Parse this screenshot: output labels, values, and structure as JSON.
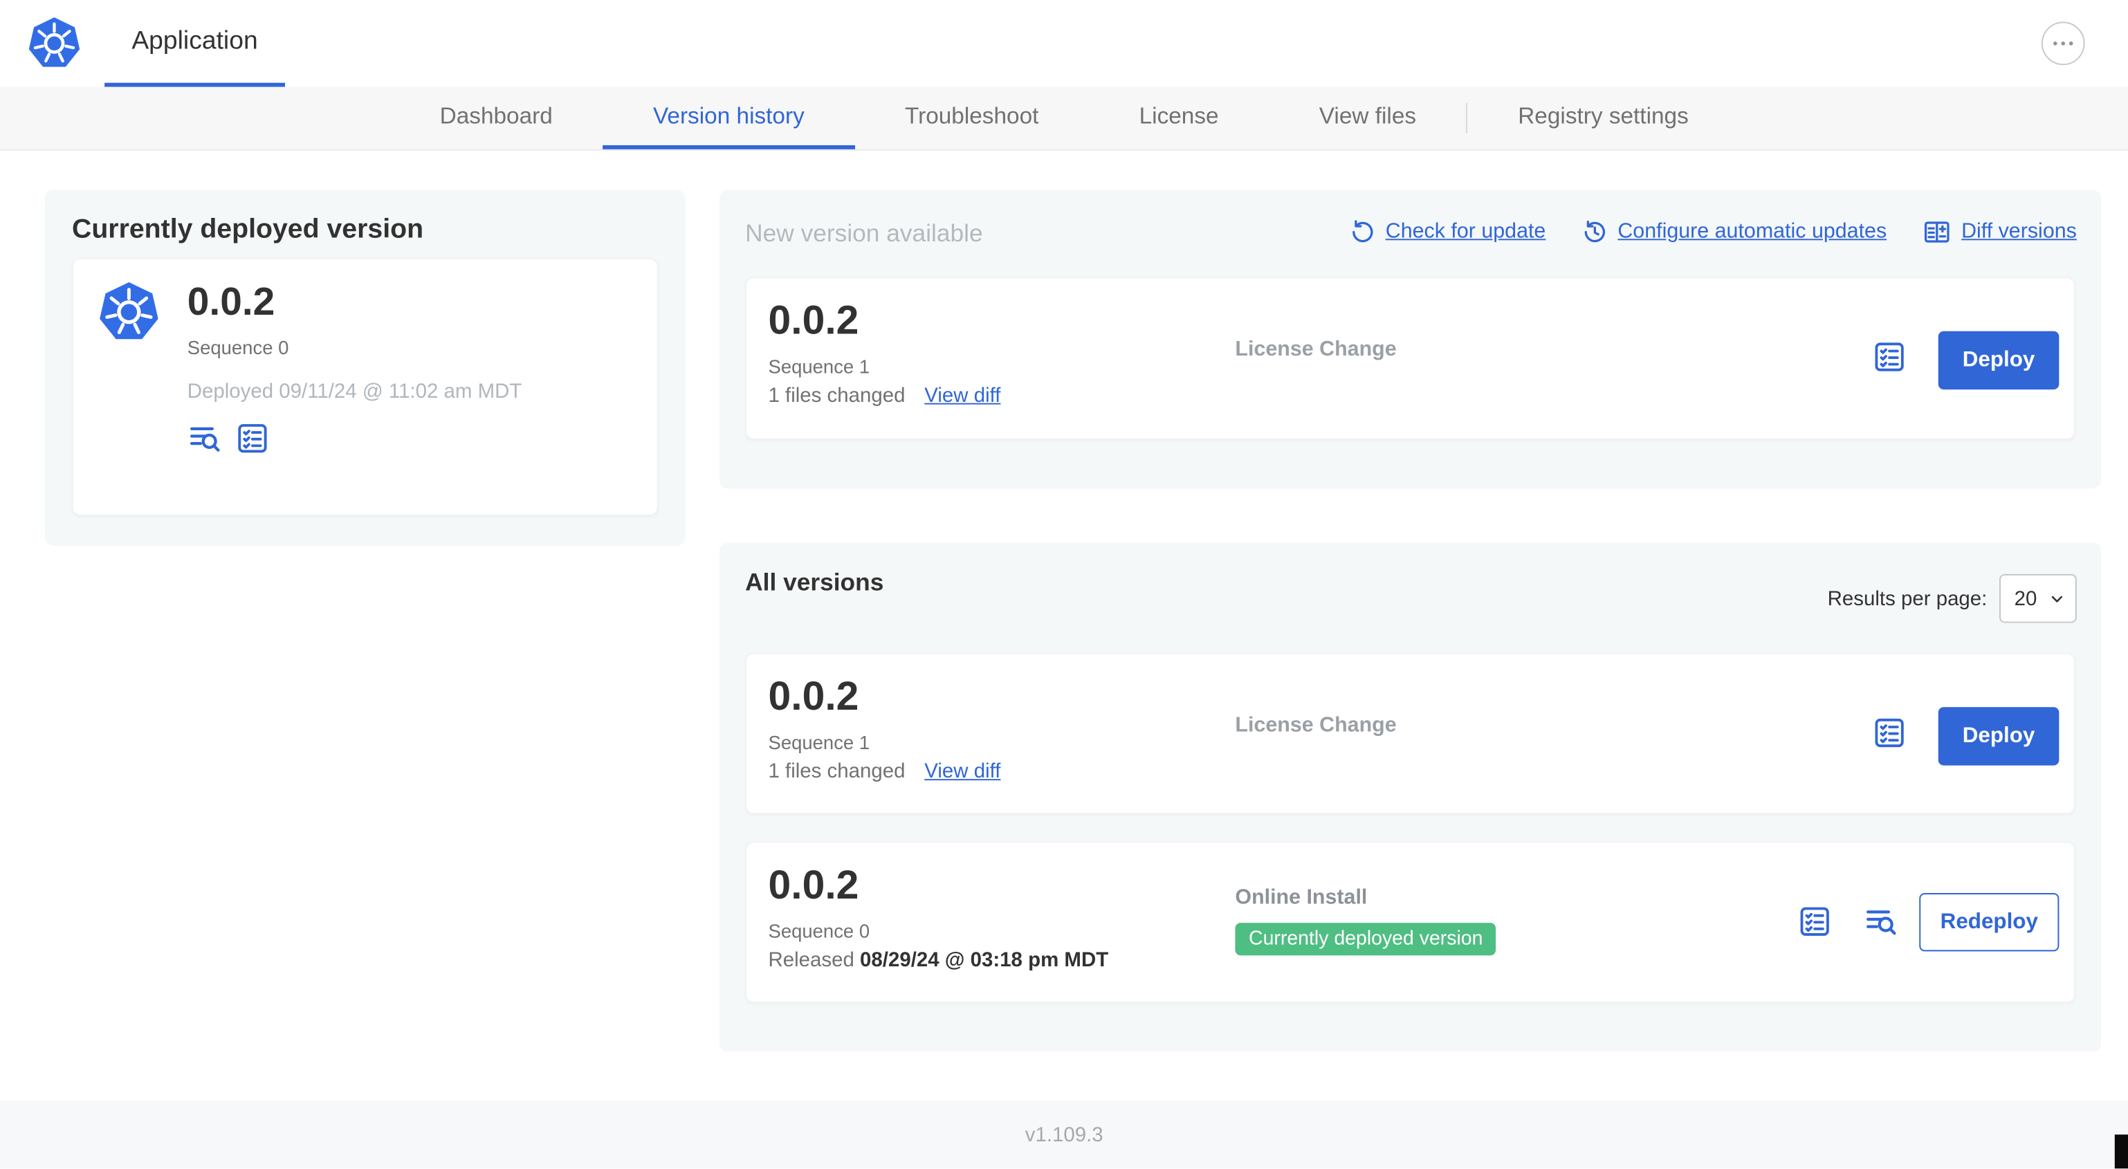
{
  "colors": {
    "accent": "#3066d6",
    "k8s_blue": "#326de6",
    "badge_green": "#4fbe83",
    "card_bg": "#f5f8f9"
  },
  "icons": {
    "kubernetes-logo": "blue-heptagon-helm-wheel",
    "more": "horizontal-ellipsis-dots",
    "check-for-update": "circular-refresh-arrow",
    "configure-automatic-updates": "clock-with-refresh-arrow",
    "diff-versions": "split-table-diff",
    "release-notes": "checklist-in-rounded-square",
    "view-logs": "text-lines-with-magnifier",
    "select-chevron": "chevron-down"
  },
  "header": {
    "app_tab": "Application"
  },
  "nav": {
    "tabs": [
      {
        "label": "Dashboard",
        "active": false
      },
      {
        "label": "Version history",
        "active": true
      },
      {
        "label": "Troubleshoot",
        "active": false
      },
      {
        "label": "License",
        "active": false
      },
      {
        "label": "View files",
        "active": false
      },
      {
        "label": "Registry settings",
        "active": false
      }
    ]
  },
  "current_version": {
    "title": "Currently deployed version",
    "version": "0.0.2",
    "sequence": "Sequence 0",
    "deployed": "Deployed 09/11/24 @ 11:02 am MDT"
  },
  "new_version": {
    "title": "New version available",
    "actions": [
      {
        "label": "Check for update"
      },
      {
        "label": "Configure automatic updates"
      },
      {
        "label": "Diff versions"
      }
    ],
    "card": {
      "version": "0.0.2",
      "sequence": "Sequence 1",
      "files_changed": "1 files changed",
      "view_diff": "View diff",
      "source": "License Change",
      "deploy_label": "Deploy"
    }
  },
  "all_versions": {
    "title": "All versions",
    "results_per_page_label": "Results per page:",
    "results_per_page_value": "20",
    "rows": [
      {
        "version": "0.0.2",
        "sequence": "Sequence 1",
        "files_changed": "1 files changed",
        "view_diff": "View diff",
        "source": "License Change",
        "action_label": "Deploy"
      },
      {
        "version": "0.0.2",
        "sequence": "Sequence 0",
        "released_prefix": "Released",
        "released_date": "08/29/24 @ 03:18 pm MDT",
        "source": "Online Install",
        "badge": "Currently deployed version",
        "action_label": "Redeploy"
      }
    ]
  },
  "footer": {
    "version": "v1.109.3"
  }
}
